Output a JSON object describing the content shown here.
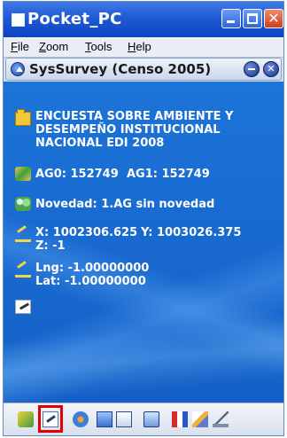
{
  "window": {
    "title": "Pocket_PC"
  },
  "menu": {
    "items": [
      {
        "underlined": "F",
        "rest": "ile"
      },
      {
        "underlined": "Z",
        "rest": "oom"
      },
      {
        "underlined": "T",
        "rest": "ools"
      },
      {
        "underlined": "H",
        "rest": "elp"
      }
    ]
  },
  "app": {
    "title": "SysSurvey  (Censo 2005)"
  },
  "content": {
    "survey_title": "ENCUESTA SOBRE AMBIENTE Y DESEMPEÑO INSTITUCIONAL NACIONAL EDI 2008",
    "ag0": "AG0: 152749",
    "ag1": "AG1: 152749",
    "novedad": "Novedad:  1.AG sin novedad",
    "x_coord": "X: 1002306.625",
    "y_coord": "Y: 1003026.375",
    "z_coord": "Z: -1",
    "lng": "Lng: -1.00000000",
    "lat": "Lat: -1.00000000"
  },
  "toolbar": {
    "icons": [
      "survey-icon",
      "edit-form-icon",
      "settings-icon",
      "document-icon",
      "copy-icon",
      "users-icon",
      "flag-icon",
      "pen-icon",
      "signal-icon"
    ],
    "selected_index": 1,
    "highlight_color": "#e10000"
  },
  "colors": {
    "title_bar": "#1f59d4",
    "content_background": "#1869d0",
    "content_text": "#ffffff"
  }
}
